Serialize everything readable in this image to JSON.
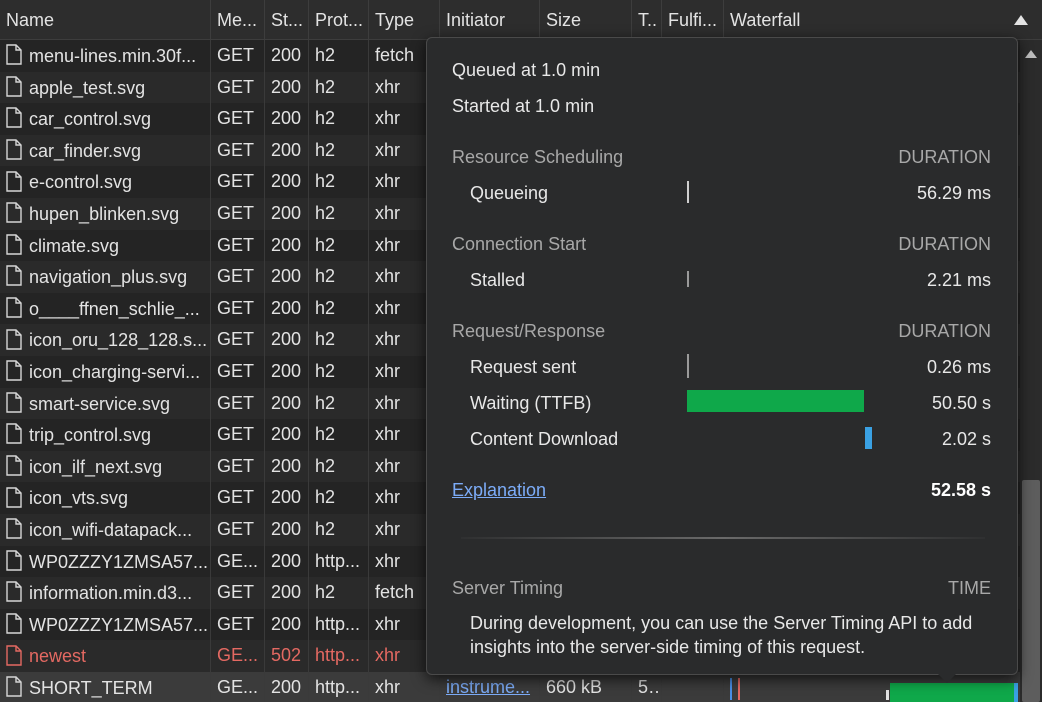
{
  "columns": {
    "name": "Name",
    "method": "Me...",
    "status": "St...",
    "protocol": "Prot...",
    "type": "Type",
    "initiator": "Initiator",
    "size": "Size",
    "time": "T..",
    "fulfilled": "Fulfi...",
    "waterfall": "Waterfall"
  },
  "rows": [
    {
      "name": "menu-lines.min.30f...",
      "method": "GET",
      "status": "200",
      "protocol": "h2",
      "type": "fetch"
    },
    {
      "name": "apple_test.svg",
      "method": "GET",
      "status": "200",
      "protocol": "h2",
      "type": "xhr"
    },
    {
      "name": "car_control.svg",
      "method": "GET",
      "status": "200",
      "protocol": "h2",
      "type": "xhr"
    },
    {
      "name": "car_finder.svg",
      "method": "GET",
      "status": "200",
      "protocol": "h2",
      "type": "xhr"
    },
    {
      "name": "e-control.svg",
      "method": "GET",
      "status": "200",
      "protocol": "h2",
      "type": "xhr"
    },
    {
      "name": "hupen_blinken.svg",
      "method": "GET",
      "status": "200",
      "protocol": "h2",
      "type": "xhr"
    },
    {
      "name": "climate.svg",
      "method": "GET",
      "status": "200",
      "protocol": "h2",
      "type": "xhr"
    },
    {
      "name": "navigation_plus.svg",
      "method": "GET",
      "status": "200",
      "protocol": "h2",
      "type": "xhr"
    },
    {
      "name": "o____ffnen_schlie_...",
      "method": "GET",
      "status": "200",
      "protocol": "h2",
      "type": "xhr"
    },
    {
      "name": "icon_oru_128_128.s...",
      "method": "GET",
      "status": "200",
      "protocol": "h2",
      "type": "xhr"
    },
    {
      "name": "icon_charging-servi...",
      "method": "GET",
      "status": "200",
      "protocol": "h2",
      "type": "xhr"
    },
    {
      "name": "smart-service.svg",
      "method": "GET",
      "status": "200",
      "protocol": "h2",
      "type": "xhr"
    },
    {
      "name": "trip_control.svg",
      "method": "GET",
      "status": "200",
      "protocol": "h2",
      "type": "xhr"
    },
    {
      "name": "icon_ilf_next.svg",
      "method": "GET",
      "status": "200",
      "protocol": "h2",
      "type": "xhr"
    },
    {
      "name": "icon_vts.svg",
      "method": "GET",
      "status": "200",
      "protocol": "h2",
      "type": "xhr"
    },
    {
      "name": "icon_wifi-datapack...",
      "method": "GET",
      "status": "200",
      "protocol": "h2",
      "type": "xhr"
    },
    {
      "name": "WP0ZZZY1ZMSA57...",
      "method": "GE...",
      "status": "200",
      "protocol": "http...",
      "type": "xhr"
    },
    {
      "name": "information.min.d3...",
      "method": "GET",
      "status": "200",
      "protocol": "h2",
      "type": "fetch"
    },
    {
      "name": "WP0ZZZY1ZMSA57...",
      "method": "GET",
      "status": "200",
      "protocol": "http...",
      "type": "xhr"
    },
    {
      "name": "newest",
      "method": "GE...",
      "status": "502",
      "protocol": "http...",
      "type": "xhr"
    },
    {
      "name": "SHORT_TERM",
      "method": "GE...",
      "status": "200",
      "protocol": "http...",
      "type": "xhr",
      "initiator": "instrume...",
      "size": "660 kB",
      "time": "5..."
    }
  ],
  "timing": {
    "queued": "Queued at 1.0 min",
    "started": "Started at 1.0 min",
    "resource_scheduling": "Resource Scheduling",
    "connection_start": "Connection Start",
    "request_response": "Request/Response",
    "duration_header": "DURATION",
    "queueing_label": "Queueing",
    "queueing_value": "56.29 ms",
    "stalled_label": "Stalled",
    "stalled_value": "2.21 ms",
    "request_sent_label": "Request sent",
    "request_sent_value": "0.26 ms",
    "waiting_label": "Waiting (TTFB)",
    "waiting_value": "50.50 s",
    "download_label": "Content Download",
    "download_value": "2.02 s",
    "explanation": "Explanation",
    "total": "52.58 s",
    "server_timing": "Server Timing",
    "time_header": "TIME",
    "server_timing_text": "During development, you can use the Server Timing API to add insights into the server-side timing of this request."
  },
  "colors": {
    "waiting_bar": "#0fa84a",
    "download_bar": "#3aa1e3",
    "error_text": "#e46962",
    "link": "#7cacf8"
  }
}
